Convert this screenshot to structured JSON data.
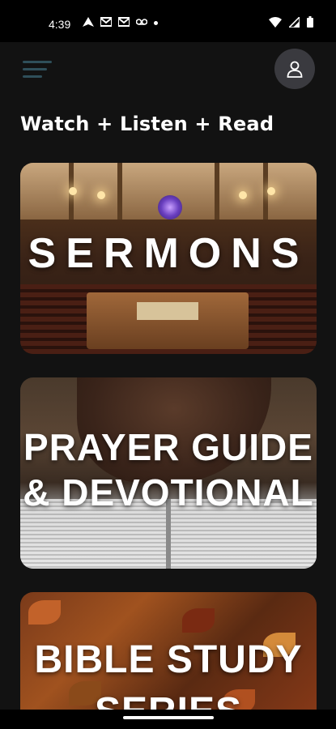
{
  "status_bar": {
    "time": "4:39",
    "icons_left": [
      "navigation-icon",
      "gmail-icon",
      "gmail-icon",
      "voicemail-icon",
      "notification-dot-icon"
    ],
    "icons_right": [
      "wifi-icon",
      "signal-icon",
      "battery-icon"
    ]
  },
  "header": {
    "menu_icon": "hamburger-menu-icon",
    "profile_icon": "user-profile-icon"
  },
  "main": {
    "section_title": "Watch + Listen + Read",
    "cards": [
      {
        "title": "SERMONS"
      },
      {
        "title_line1": "PRAYER GUIDE",
        "title_line2": "& DEVOTIONAL"
      },
      {
        "title_line1": "BIBLE STUDY",
        "title_line2": "SERIES"
      }
    ]
  },
  "colors": {
    "background": "#121212",
    "menu_icon": "#2f4f5a",
    "profile_button": "#3a3a3f",
    "text": "#ffffff"
  }
}
